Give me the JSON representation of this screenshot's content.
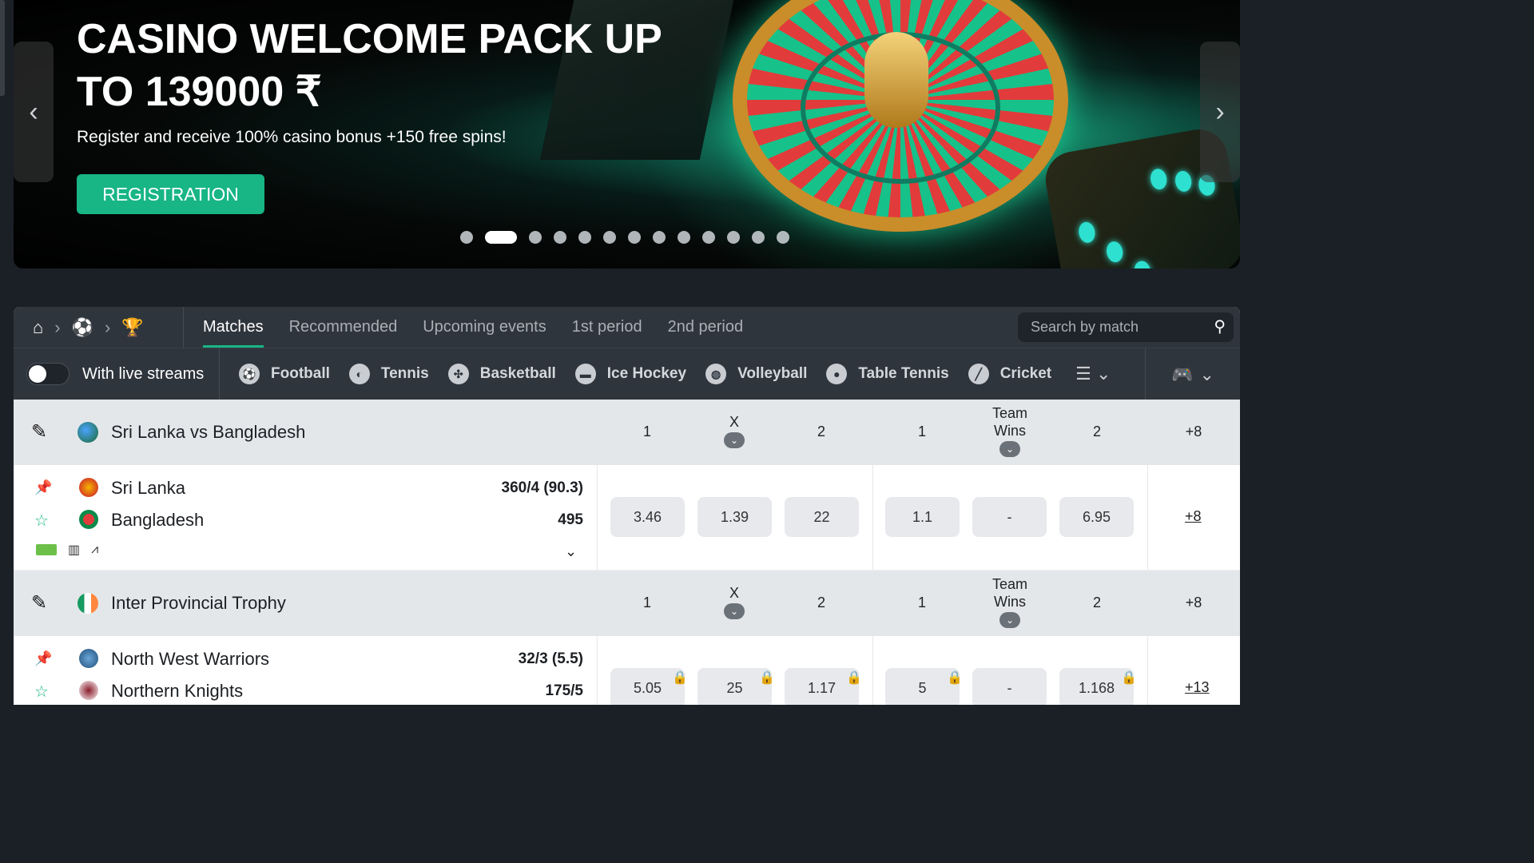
{
  "banner": {
    "title": "CASINO WELCOME PACK UP TO 139000 ₹",
    "subtitle": "Register and receive 100% casino bonus +150 free spins!",
    "cta": "REGISTRATION",
    "prev_icon": "‹",
    "next_icon": "›",
    "slides_total": 13,
    "active_slide": 2
  },
  "tabs": {
    "items": [
      "Matches",
      "Recommended",
      "Upcoming events",
      "1st period",
      "2nd period"
    ],
    "active": "Matches",
    "search_placeholder": "Search by match"
  },
  "sports_bar": {
    "live_label": "With live streams",
    "sports": [
      "Football",
      "Tennis",
      "Basketball",
      "Ice Hockey",
      "Volleyball",
      "Table Tennis",
      "Cricket"
    ]
  },
  "colors": {
    "accent": "#18b585",
    "dark_bar": "#2f353d",
    "league_bg": "#e4e7ea"
  },
  "leagues": [
    {
      "name": "Sri Lanka vs Bangladesh",
      "headers": [
        "1",
        "X",
        "2",
        "1",
        "Team Wins",
        "2",
        "+8"
      ],
      "match": {
        "team1": "Sri Lanka",
        "team2": "Bangladesh",
        "score1": "360/4 (90.3)",
        "score2": "495",
        "odds": [
          "3.46",
          "1.39",
          "22",
          "1.1",
          "-",
          "6.95"
        ],
        "more": "+8"
      }
    },
    {
      "name": "Inter Provincial Trophy",
      "headers": [
        "1",
        "X",
        "2",
        "1",
        "Team Wins",
        "2",
        "+8"
      ],
      "match": {
        "team1": "North West Warriors",
        "team2": "Northern Knights",
        "score1": "32/3 (5.5)",
        "score2": "175/5",
        "odds": [
          "5.05",
          "25",
          "1.17",
          "5",
          "-",
          "1.168"
        ],
        "more": "+13"
      }
    }
  ]
}
